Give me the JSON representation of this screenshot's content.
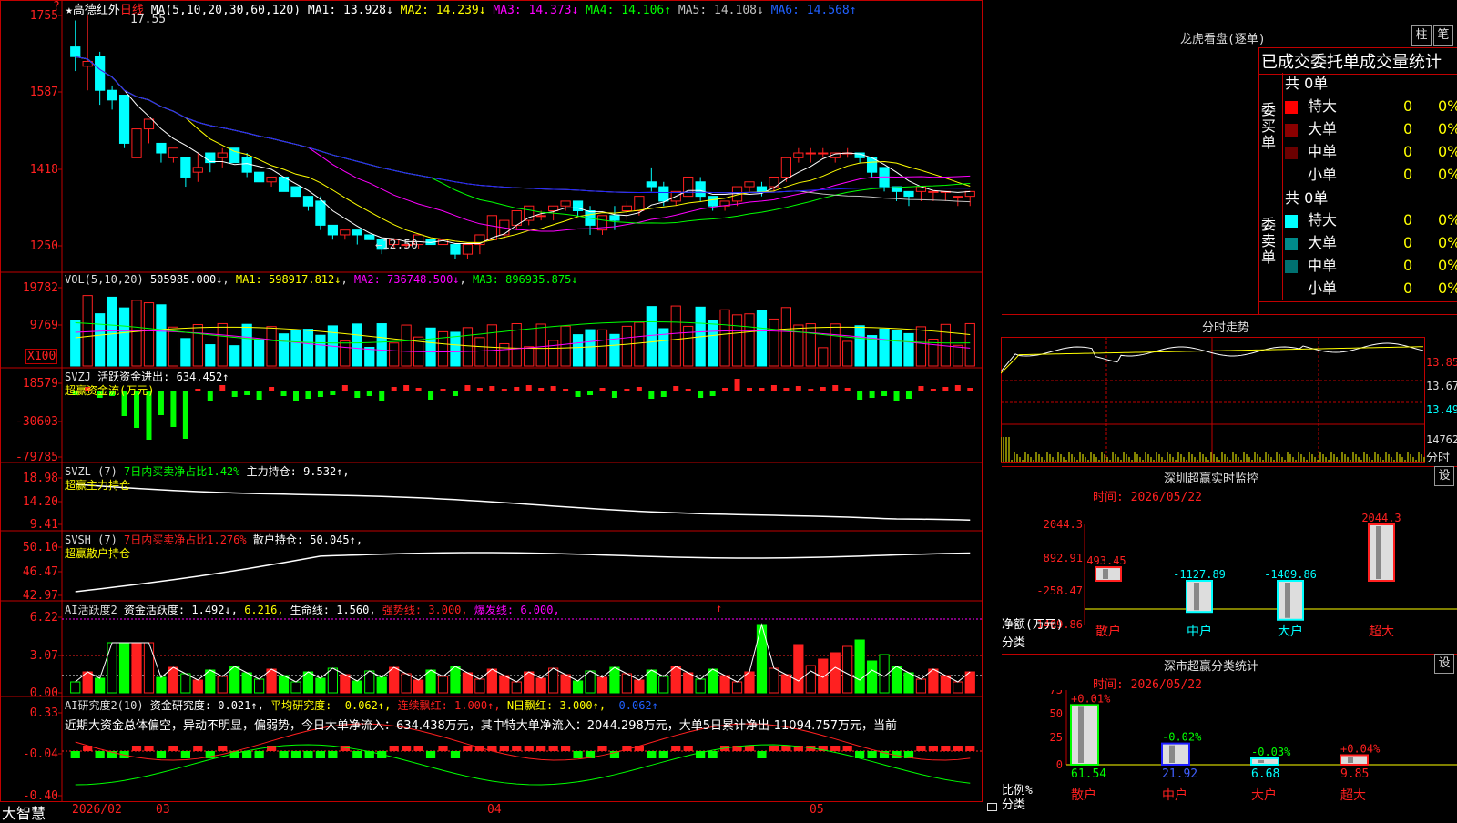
{
  "colors": {
    "up": "#ff2020",
    "down": "#00ffff",
    "grid": "#c00000",
    "ma1": "#ffffff",
    "ma2": "#ffff00",
    "ma3": "#ff00ff",
    "ma4": "#00ff00",
    "ma5": "#c0c0c0",
    "ma6": "#2020ff",
    "green_bar": "#00ff00"
  },
  "stock": {
    "star": "★",
    "name": "高德红外",
    "period": "日线",
    "ma_label": "MA(5,10,20,30,60,120)",
    "ma1": "MA1: 13.928↓",
    "ma2": "MA2: 14.239↓",
    "ma3": "MA3: 14.373↓",
    "ma4": "MA4: 14.106↑",
    "ma5": "MA5: 14.108↓",
    "ma6": "MA6: 14.568↑",
    "high_mark": "17.55",
    "low_mark": "←12.50",
    "y_ticks": [
      "1755",
      "1587",
      "1418",
      "1250"
    ],
    "question": "?"
  },
  "vol": {
    "label": "VOL(5,10,20)",
    "value": "505985.000↓",
    "ma1": "MA1: 598917.812↓",
    "ma2": "MA2: 736748.500↓",
    "ma3": "MA3: 896935.875↓",
    "y_ticks": [
      "19782",
      "9769"
    ],
    "unit": "X100"
  },
  "svzj": {
    "label": "SVZJ",
    "text": "活跃资金进出: 634.452↑",
    "sub": "超赢资金流(万元)",
    "y_ticks": [
      "18579",
      "-30603",
      "-79785"
    ]
  },
  "svzl": {
    "label": "SVZL (7)",
    "pct": "7日内买卖净占比1.42%",
    "hold": "主力持仓: 9.532↑,",
    "sub": "超赢主力持仓",
    "y_ticks": [
      "18.98",
      "14.20",
      "9.41"
    ]
  },
  "svsh": {
    "label": "SVSH (7)",
    "pct": "7日内买卖净占比1.276%",
    "hold": "散户持仓: 50.045↑,",
    "sub": "超赢散户持仓",
    "y_ticks": [
      "50.10",
      "46.47",
      "42.97"
    ]
  },
  "ai_active": {
    "label": "AI活跃度2",
    "v1": "资金活跃度: 1.492↓,",
    "v2": "6.216,",
    "v3": "生命线: 1.560,",
    "v4": "强势线: 3.000,",
    "v5": "爆发线: 6.000,",
    "arrow": "↑",
    "y_ticks": [
      "6.22",
      "3.07",
      "0.00"
    ]
  },
  "ai_research": {
    "label": "AI研究度2(10)",
    "v1": "资金研究度: 0.021↑,",
    "v2": "平均研究度: -0.062↑,",
    "v3": "连续飘红: 1.000↑,",
    "v4": "N日飘红: 3.000↑,",
    "v5": "-0.062↑",
    "text": "近期大资金总体偏空，异动不明显，偏弱势，今日大单净流入：634.438万元，其中特大单净流入：2044.298万元，大单5日累计净出-11094.757万元，当前",
    "y_ticks": [
      "0.33",
      "-0.04",
      "-0.40"
    ]
  },
  "bottom": {
    "brand": "大智慧",
    "dates": [
      "2026/02",
      "03",
      "04",
      "05"
    ]
  },
  "lhb": {
    "title": "龙虎看盘(逐单)",
    "btn_bar": "柱",
    "btn_line": "笔",
    "header": "已成交委托单成交量统计",
    "buy": {
      "side": "委买单",
      "total": "共 0单",
      "rows": [
        {
          "name": "特大",
          "val": "0",
          "pct": "0%",
          "color": "#ff0000"
        },
        {
          "name": "大单",
          "val": "0",
          "pct": "0%",
          "color": "#8b0000"
        },
        {
          "name": "中单",
          "val": "0",
          "pct": "0%",
          "color": "#6b0000"
        },
        {
          "name": "小单",
          "val": "0",
          "pct": "0%",
          "color": ""
        }
      ]
    },
    "sell": {
      "side": "委卖单",
      "total": "共 0单",
      "rows": [
        {
          "name": "特大",
          "val": "0",
          "pct": "0%",
          "color": "#00ffff"
        },
        {
          "name": "大单",
          "val": "0",
          "pct": "0%",
          "color": "#008b8b"
        },
        {
          "name": "中单",
          "val": "0",
          "pct": "0%",
          "color": "#007070"
        },
        {
          "name": "小单",
          "val": "0",
          "pct": "0%",
          "color": ""
        }
      ]
    }
  },
  "intraday": {
    "title": "分时走势",
    "y_ticks": [
      "13.85",
      "13.67",
      "13.49",
      "14762"
    ],
    "vol_label": "分时"
  },
  "sz_monitor": {
    "title": "深圳超赢实时监控",
    "btn": "设",
    "time": "时间: 2026/05/22",
    "y_ticks": [
      "2044.3",
      "892.91",
      "-258.47",
      "-1409.86"
    ],
    "y_label": "净额(万元)",
    "x_label": "分类",
    "categories": [
      "散户",
      "中户",
      "大户",
      "超大"
    ],
    "values": [
      "493.45",
      "-1127.89",
      "-1409.86",
      "2044.3"
    ]
  },
  "sz_class": {
    "title": "深市超赢分类统计",
    "btn": "设",
    "time": "时间: 2026/05/22",
    "y_ticks": [
      "75",
      "50",
      "25",
      "0"
    ],
    "y_label": "比例%",
    "x_label": "分类",
    "categories": [
      "散户",
      "中户",
      "大户",
      "超大"
    ],
    "values": [
      "61.54",
      "21.92",
      "6.68",
      "9.85"
    ],
    "changes": [
      "+0.01%",
      "-0.02%",
      "-0.03%",
      "+0.04%"
    ]
  },
  "chart_data": {
    "type": "candlestick",
    "candles": [
      [
        16.9,
        17.45,
        16.7,
        16.4
      ],
      [
        16.5,
        17.55,
        16.6,
        16.0
      ],
      [
        16.7,
        16.8,
        16.0,
        15.7
      ],
      [
        16.0,
        16.1,
        15.8,
        15.6
      ],
      [
        15.9,
        15.9,
        14.9,
        14.8
      ],
      [
        14.6,
        14.9,
        15.2,
        14.6
      ],
      [
        15.2,
        15.3,
        15.4,
        14.9
      ],
      [
        14.9,
        14.9,
        14.7,
        14.5
      ],
      [
        14.6,
        14.6,
        14.8,
        14.5
      ],
      [
        14.6,
        14.6,
        14.2,
        14.0
      ],
      [
        14.3,
        14.7,
        14.4,
        14.1
      ],
      [
        14.7,
        14.6,
        14.5,
        14.3
      ],
      [
        14.6,
        14.8,
        14.7,
        14.4
      ],
      [
        14.8,
        14.8,
        14.5,
        14.5
      ],
      [
        14.6,
        14.7,
        14.3,
        14.2
      ],
      [
        14.3,
        14.3,
        14.1,
        14.1
      ],
      [
        14.1,
        14.1,
        14.2,
        14.0
      ],
      [
        14.2,
        14.2,
        13.9,
        13.9
      ],
      [
        14.0,
        14.0,
        13.8,
        13.8
      ],
      [
        13.8,
        13.8,
        13.6,
        13.5
      ],
      [
        13.7,
        13.8,
        13.2,
        13.1
      ],
      [
        13.2,
        13.2,
        13.0,
        12.9
      ],
      [
        13.0,
        13.0,
        13.1,
        12.9
      ],
      [
        13.1,
        13.1,
        13.0,
        12.8
      ],
      [
        13.0,
        13.0,
        12.9,
        12.9
      ],
      [
        12.9,
        12.9,
        12.7,
        12.6
      ],
      [
        12.8,
        12.8,
        12.9,
        12.7
      ],
      [
        12.8,
        12.8,
        12.8,
        12.7
      ],
      [
        12.8,
        12.8,
        13.0,
        12.7
      ],
      [
        12.9,
        12.9,
        12.8,
        12.8
      ],
      [
        12.8,
        13.0,
        12.9,
        12.7
      ],
      [
        12.8,
        12.8,
        12.6,
        12.5
      ],
      [
        12.6,
        12.7,
        12.8,
        12.5
      ],
      [
        12.8,
        12.8,
        13.0,
        12.6
      ],
      [
        12.9,
        13.1,
        13.4,
        12.9
      ],
      [
        13.0,
        13.0,
        13.3,
        12.9
      ],
      [
        13.2,
        13.2,
        13.5,
        13.1
      ],
      [
        13.3,
        13.5,
        13.6,
        13.2
      ],
      [
        13.4,
        13.5,
        13.4,
        13.3
      ],
      [
        13.5,
        13.5,
        13.6,
        13.3
      ],
      [
        13.6,
        13.6,
        13.7,
        13.5
      ],
      [
        13.7,
        13.7,
        13.5,
        13.4
      ],
      [
        13.5,
        13.6,
        13.2,
        13.0
      ],
      [
        13.1,
        13.3,
        13.4,
        13.0
      ],
      [
        13.4,
        13.6,
        13.3,
        13.1
      ],
      [
        13.5,
        13.7,
        13.6,
        13.3
      ],
      [
        13.5,
        13.5,
        13.8,
        13.4
      ],
      [
        14.1,
        14.4,
        14.0,
        13.9
      ],
      [
        14.0,
        14.1,
        13.7,
        13.6
      ],
      [
        13.7,
        13.7,
        13.9,
        13.6
      ],
      [
        13.8,
        14.0,
        14.2,
        13.8
      ],
      [
        14.1,
        14.2,
        13.8,
        13.7
      ],
      [
        13.8,
        13.8,
        13.6,
        13.5
      ],
      [
        13.6,
        13.6,
        13.7,
        13.5
      ],
      [
        13.7,
        13.7,
        14.0,
        13.6
      ],
      [
        14.0,
        14.0,
        14.1,
        13.9
      ],
      [
        14.0,
        14.1,
        13.9,
        13.8
      ],
      [
        14.0,
        14.1,
        14.2,
        13.9
      ],
      [
        14.2,
        14.5,
        14.6,
        14.1
      ],
      [
        14.6,
        14.8,
        14.7,
        14.5
      ],
      [
        14.7,
        14.8,
        14.7,
        14.5
      ],
      [
        14.7,
        14.8,
        14.7,
        14.6
      ],
      [
        14.6,
        14.7,
        14.7,
        14.5
      ],
      [
        14.7,
        14.8,
        14.7,
        14.6
      ],
      [
        14.7,
        14.7,
        14.6,
        14.5
      ],
      [
        14.6,
        14.6,
        14.3,
        14.2
      ],
      [
        14.4,
        14.4,
        14.0,
        13.9
      ],
      [
        14.0,
        14.0,
        13.9,
        13.7
      ],
      [
        13.9,
        13.9,
        13.8,
        13.6
      ],
      [
        13.9,
        13.9,
        14.0,
        13.7
      ],
      [
        13.9,
        13.9,
        13.9,
        13.7
      ],
      [
        13.9,
        13.9,
        13.9,
        13.7
      ],
      [
        13.8,
        13.8,
        13.8,
        13.6
      ],
      [
        13.8,
        13.8,
        13.9,
        13.6
      ]
    ],
    "ylim": [
      12.3,
      17.8
    ]
  }
}
